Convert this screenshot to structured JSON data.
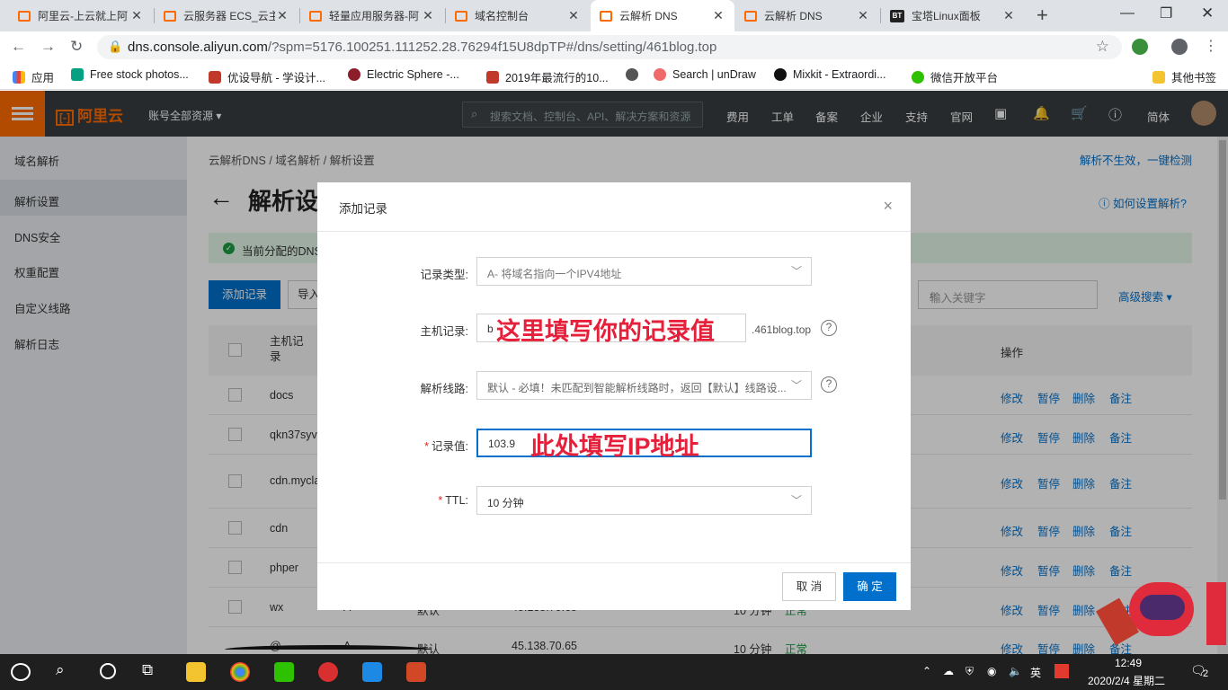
{
  "browser": {
    "tabs": [
      {
        "title": "阿里云-上云就上阿",
        "icon": "aliyun-icon"
      },
      {
        "title": "云服务器 ECS_云主",
        "icon": "aliyun-icon"
      },
      {
        "title": "轻量应用服务器-阿",
        "icon": "aliyun-icon"
      },
      {
        "title": "域名控制台",
        "icon": "aliyun-icon"
      },
      {
        "title": "云解析 DNS",
        "icon": "aliyun-icon",
        "active": true
      },
      {
        "title": "云解析 DNS",
        "icon": "aliyun-icon"
      },
      {
        "title": "宝塔Linux面板",
        "icon": "bt-icon"
      }
    ],
    "bt_badge": "BT",
    "url_host": "dns.console.aliyun.com",
    "url_path": "/?spm=5176.100251.111252.28.76294f15U8dpTP#/dns/setting/461blog.top",
    "bookmarks": [
      {
        "label": "应用"
      },
      {
        "label": "Free stock photos..."
      },
      {
        "label": "优设导航 - 学设计..."
      },
      {
        "label": "Electric Sphere -..."
      },
      {
        "label": "2019年最流行的10..."
      },
      {
        "label": ""
      },
      {
        "label": "Search | unDraw"
      },
      {
        "label": "Mixkit - Extraordi..."
      },
      {
        "label": "微信开放平台"
      }
    ],
    "other_bookmarks": "其他书签"
  },
  "header": {
    "logo": "阿里云",
    "account": "账号全部资源 ▾",
    "search_placeholder": "搜索文档、控制台、API、解决方案和资源",
    "links": [
      "费用",
      "工单",
      "备案",
      "企业",
      "支持",
      "官网"
    ],
    "lang": "简体"
  },
  "sidebar": {
    "items": [
      "域名解析",
      "解析设置",
      "DNS安全",
      "权重配置",
      "自定义线路",
      "解析日志"
    ]
  },
  "main": {
    "breadcrumb": "云解析DNS  /  域名解析  /  解析设置",
    "help_link": "解析不生效，一键检测",
    "title": "解析设",
    "howto": "如何设置解析?",
    "alert": "当前分配的DNS",
    "add_button": "添加记录",
    "import_button": "导入",
    "keyword_placeholder": "输入关键字",
    "advanced_search": "高级搜索 ▾",
    "col_host": "主机记录",
    "col_ops": "操作",
    "rows": [
      {
        "host": "docs"
      },
      {
        "host": "qkn37syvp"
      },
      {
        "host": "cdn.mycla"
      },
      {
        "host": "cdn"
      },
      {
        "host": "phper"
      },
      {
        "host": "wx",
        "type": "A",
        "line": "默认",
        "value": "45.138.70.65",
        "ttl": "10 分钟",
        "status": "正常"
      },
      {
        "host": "@",
        "type": "A",
        "line": "默认",
        "value": "45.138.70.65",
        "ttl": "10 分钟",
        "status": "正常"
      }
    ],
    "ops": [
      "修改",
      "暂停",
      "删除",
      "备注"
    ]
  },
  "dialog": {
    "title": "添加记录",
    "close": "×",
    "record_type_label": "记录类型:",
    "record_type_value": "A- 将域名指向一个IPV4地址",
    "host_label": "主机记录:",
    "host_value": "b",
    "host_suffix": ".461blog.top",
    "line_label": "解析线路:",
    "line_value": "默认 - 必填！未匹配到智能解析线路时，返回【默认】线路设...",
    "value_label": "记录值:",
    "value_value": "103.9",
    "ttl_label": "TTL:",
    "ttl_value": "10 分钟",
    "cancel": "取 消",
    "ok": "确 定",
    "annotation_host": "这里填写你的记录值",
    "annotation_ip": "此处填写IP地址"
  },
  "taskbar": {
    "time": "12:49",
    "date": "2020/2/4 星期二",
    "ime": "英",
    "notification_count": "2"
  }
}
